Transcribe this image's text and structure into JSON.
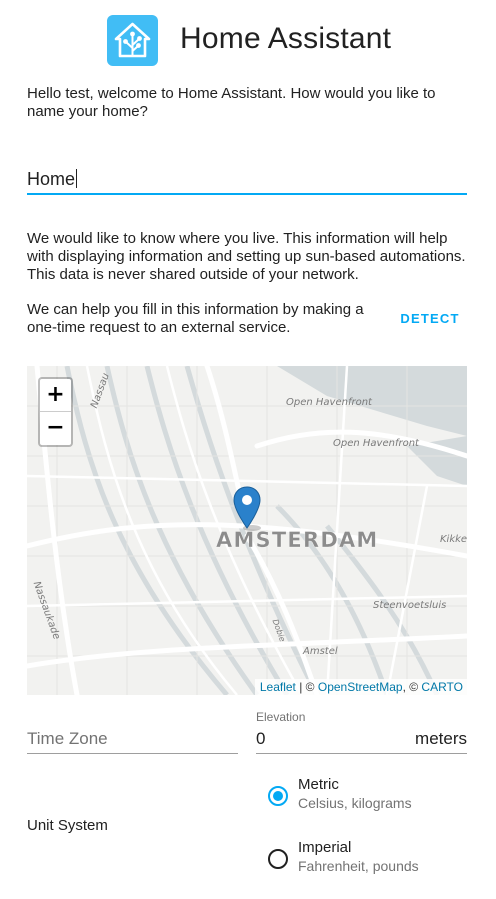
{
  "app": {
    "title": "Home Assistant"
  },
  "intro": {
    "text": "Hello test, welcome to Home Assistant. How would you like to name your home?"
  },
  "name_input": {
    "value": "Home"
  },
  "location": {
    "info_text": "We would like to know where you live. This information will help with displaying information and setting up sun-based automations. This data is never shared outside of your network.",
    "detect_text": "We can help you fill in this information by making a one-time request to an external service.",
    "detect_label": "DETECT"
  },
  "map": {
    "zoom_in": "+",
    "zoom_out": "−",
    "labels": {
      "nassau": "Nassau",
      "open_havenfront_1": "Open Havenfront",
      "open_havenfront_2": "Open Havenfront",
      "kikke": "Kikke",
      "steenvoetsluis": "Steenvoetsluis",
      "nassaukade": "Nassaukade",
      "amstel": "Amstel",
      "dobie": "Dobie",
      "city": "AMSTERDAM"
    },
    "attribution": {
      "leaflet": "Leaflet",
      "sep1": " | © ",
      "osm": "OpenStreetMap",
      "sep2": ", © ",
      "carto": "CARTO"
    }
  },
  "timezone": {
    "placeholder": "Time Zone"
  },
  "elevation": {
    "label": "Elevation",
    "value": "0",
    "suffix": "meters"
  },
  "unit_system": {
    "label": "Unit System",
    "options": [
      {
        "title": "Metric",
        "subtitle": "Celsius, kilograms",
        "selected": true
      },
      {
        "title": "Imperial",
        "subtitle": "Fahrenheit, pounds",
        "selected": false
      }
    ]
  },
  "colors": {
    "accent": "#03a9f4",
    "logo": "#41bdf5",
    "text": "#212121",
    "secondary": "#737373"
  }
}
